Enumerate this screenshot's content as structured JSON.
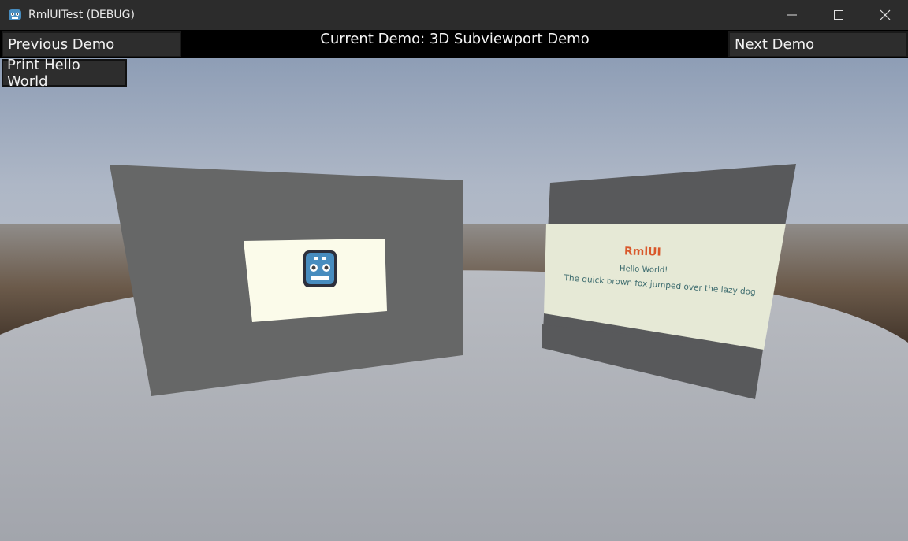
{
  "window": {
    "title": "RmlUITest (DEBUG)",
    "app_icon": "godot-icon",
    "controls": [
      "minimize-icon",
      "maximize-icon",
      "close-icon"
    ]
  },
  "toolbar": {
    "previous_label": "Previous Demo",
    "current_label": "Current Demo: 3D Subviewport Demo",
    "next_label": "Next Demo",
    "hello_label": "Print Hello World"
  },
  "scene": {
    "sky_color": "#8c9cb4",
    "ground_color": "#a6a9b0",
    "panel_color": "#666666",
    "left_panel": {
      "content_bg": "#fbfbea",
      "icon": "godot-icon"
    },
    "right_panel": {
      "content_bg": "#e6e9d6",
      "heading": "RmlUI",
      "heading_color": "#d9582b",
      "line1": "Hello World!",
      "line2": "The quick brown fox jumped over the lazy dog",
      "text_color": "#3b6a6d"
    }
  }
}
